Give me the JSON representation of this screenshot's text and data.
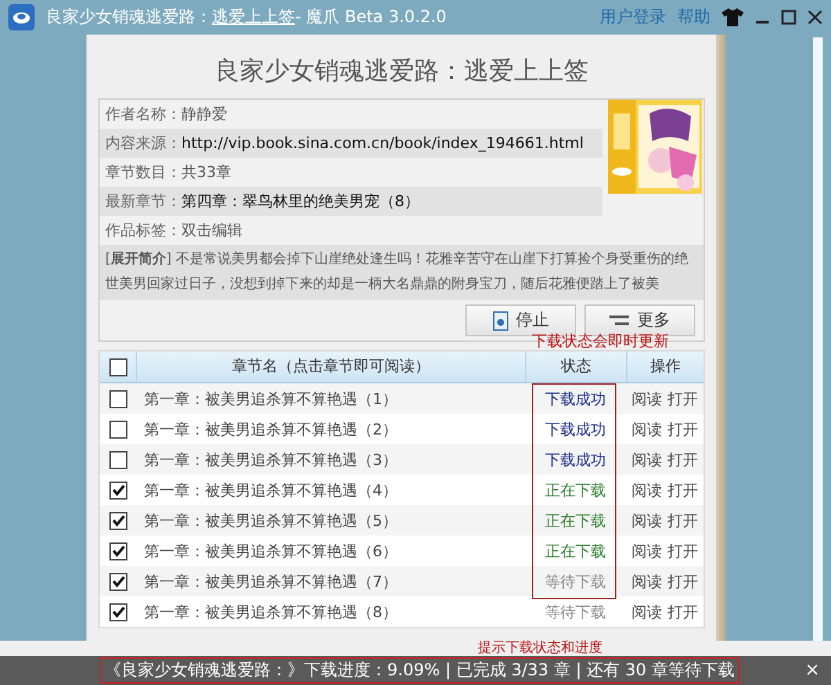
{
  "window": {
    "title_parts": [
      {
        "text": "良家少女销魂逃爱路：",
        "underlined": false
      },
      {
        "text": "逃爱上上签",
        "underlined": true
      },
      {
        "text": " - 魔爪 Beta 3.0.2.0",
        "underlined": false
      }
    ],
    "links": [
      "用户登录",
      "帮助"
    ]
  },
  "book": {
    "title": "良家少女销魂逃爱路：逃爱上上签",
    "fields": [
      {
        "label": "作者名称：",
        "value": "静静爱",
        "emphasis": false
      },
      {
        "label": "内容来源：",
        "value": "http://vip.book.sina.com.cn/book/index_194661.html",
        "emphasis": true
      },
      {
        "label": "章节数目：",
        "value": "共33章",
        "emphasis": false
      },
      {
        "label": "最新章节：",
        "value": "第四章：翠鸟林里的绝美男宠（8）",
        "emphasis": true
      },
      {
        "label": "作品标签：",
        "value": "双击编辑",
        "emphasis": false
      }
    ],
    "cover": {
      "kind": "picture"
    },
    "synopsis": "[**展开简介**] 不是常说美男都会掉下山崖绝处逢生吗！花雅辛苦守在山崖下打算捡个身受重伤的绝世美男回家过日子，没想到掉下来的却是一柄大名鼎鼎的附身宝刀，随后花雅便踏上了被美",
    "buttons": [
      "停止",
      "更多"
    ]
  },
  "table": {
    "header_checked": false,
    "columns": [
      "章节名（点击章节即可阅读）",
      "状态",
      "操作"
    ],
    "rows": [
      {
        "checked": false,
        "name": "第一章：被美男追杀算不算艳遇（1）",
        "status": "下载成功",
        "color": "#1d2d8a",
        "actions": [
          "阅读",
          "打开"
        ]
      },
      {
        "checked": false,
        "name": "第一章：被美男追杀算不算艳遇（2）",
        "status": "下载成功",
        "color": "#1d2d8a",
        "actions": [
          "阅读",
          "打开"
        ]
      },
      {
        "checked": false,
        "name": "第一章：被美男追杀算不算艳遇（3）",
        "status": "下载成功",
        "color": "#1d2d8a",
        "actions": [
          "阅读",
          "打开"
        ]
      },
      {
        "checked": true,
        "name": "第一章：被美男追杀算不算艳遇（4）",
        "status": "正在下载",
        "color": "#2a7d2a",
        "actions": [
          "阅读",
          "打开"
        ]
      },
      {
        "checked": true,
        "name": "第一章：被美男追杀算不算艳遇（5）",
        "status": "正在下载",
        "color": "#2a7d2a",
        "actions": [
          "阅读",
          "打开"
        ]
      },
      {
        "checked": true,
        "name": "第一章：被美男追杀算不算艳遇（6）",
        "status": "正在下载",
        "color": "#2a7d2a",
        "actions": [
          "阅读",
          "打开"
        ]
      },
      {
        "checked": true,
        "name": "第一章：被美男追杀算不算艳遇（7）",
        "status": "等待下载",
        "color": "#888888",
        "actions": [
          "阅读",
          "打开"
        ]
      },
      {
        "checked": true,
        "name": "第一章：被美男追杀算不算艳遇（8）",
        "status": "等待下载",
        "color": "#888888",
        "actions": [
          "阅读",
          "打开"
        ]
      }
    ]
  },
  "annotations": [
    "下载状态会即时更新",
    "提示下载状态和进度"
  ],
  "status_bar": {
    "text": "《良家少女销魂逃爱路：》下载进度：9.09% | 已完成 3/33 章 | 还有 30 章等待下载",
    "close": "×"
  }
}
